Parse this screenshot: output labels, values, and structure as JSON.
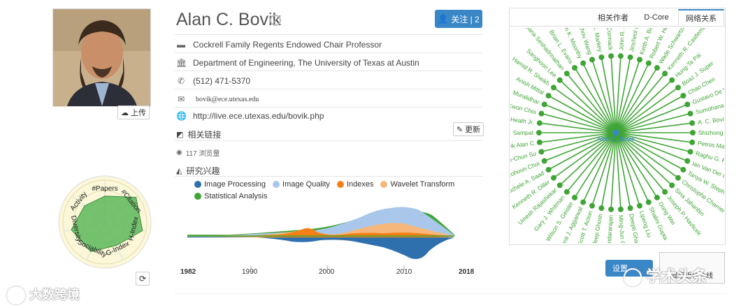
{
  "profile": {
    "name": "Alan C. Bovik",
    "position": "Cockrell Family Regents Endowed Chair Professor",
    "affiliation": "Department of Engineering, The University of Texas at Austin",
    "phone": "(512) 471-5370",
    "email": "bovik@ece.utexas.edu",
    "homepage": "http://live.ece.utexas.edu/bovik.php",
    "links_title": "相关链接",
    "views": "117 浏览量",
    "interests_title": "研究兴趣",
    "upload_label": "上传",
    "update_label": "更新",
    "follow_label": "关注 | 2"
  },
  "radar": {
    "axes": [
      "#Papers",
      "#Citation",
      "H-Index",
      "G-Index",
      "Sociability",
      "Diversity",
      "Activity"
    ],
    "values": [
      0.62,
      0.95,
      0.92,
      0.62,
      0.78,
      0.82,
      0.62
    ],
    "fill": "#5cb85c"
  },
  "tabs": [
    "相关作者",
    "D-Core",
    "网络关系"
  ],
  "active_tab": 2,
  "network": {
    "center": "Alan C. Bovik",
    "color": "#3fa535",
    "center_color": "#3a87c8",
    "nodes": [
      "John R. Jordan",
      "Jincheol Park",
      "Keith A. Bartel",
      "Robert W. Heath",
      "Wade Schwartzkopf",
      "Kenneth R. Castleman",
      "Hung-Ta Pai",
      "Boaz J. Super",
      "Chao Chen",
      "Gustavo De Veciana",
      "Sumohana S. Channappayya",
      "A. C. Bovik",
      "Shizhong Liu",
      "Petros Maragos",
      "Raghu G. Raj",
      "Ian Van Der Linde",
      "Tanya W. Stephens",
      "Christophe Charrier",
      "Sina Jahanbin",
      "Joseph P. Havlicek",
      "Dong Wei",
      "Shalini Gupta",
      "Lipeng Liu",
      "Deepti Ghadiyaram",
      "Ming-Jun Chen",
      "v. Soundararajan",
      "Joydeep Ghosh",
      "Scott T. Acton",
      "Shanti J. Aggarwal",
      "Wilson S. Geisler",
      "Gary J. Whitman",
      "Umesh Rajashekar",
      "Kenneth R. Diller",
      "Michele A. Saad",
      "Hyohoon Choi",
      "Che-Chun Su",
      "Bovik Alan C",
      "Mehul P. Sampat",
      "Robert W. Heath Jr.",
      "Lark Kwon Choi",
      "Pritam S. Muralidhar",
      "Anish Mittal",
      "Hamid R. Sheikh",
      "Sanghoon Lee",
      "Kalpana Seshadrinathan",
      "Brian L. Evans",
      "Anush K. Moorthy",
      "Zhou Wang",
      "Mia K. Markey",
      "Lawrence K. Cormack"
    ]
  },
  "interests": {
    "legend": [
      {
        "name": "Image Processing",
        "color": "#2e6fae"
      },
      {
        "name": "Image Quality",
        "color": "#a9c7ea"
      },
      {
        "name": "Indexes",
        "color": "#f57f17"
      },
      {
        "name": "Wavelet Transform",
        "color": "#f6b77c"
      },
      {
        "name": "Statistical Analysis",
        "color": "#3fa535"
      }
    ],
    "years": [
      "1982",
      "1990",
      "2000",
      "2010",
      "2018"
    ]
  },
  "buttons": {
    "settings": "设置",
    "share": "显示近代合线"
  },
  "watermark_left": "大数跨境",
  "watermark_right": "学术头条"
}
